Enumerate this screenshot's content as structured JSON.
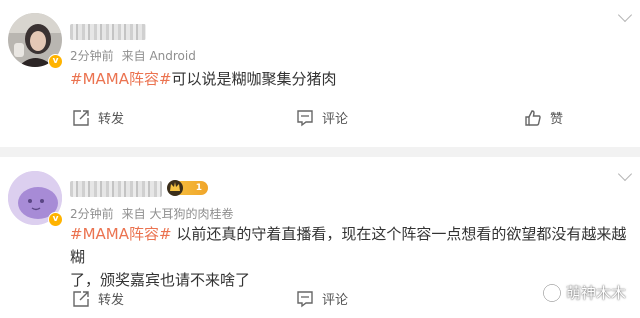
{
  "post1": {
    "meta": {
      "time": "2分钟前",
      "source": "来自 Android"
    },
    "hashtag": "#MAMA阵容#",
    "text": "可以说是糊咖聚集分猪肉",
    "actions": {
      "repost": "转发",
      "comment": "评论",
      "like": "赞"
    }
  },
  "post2": {
    "fan_level": "1",
    "meta": {
      "time": "2分钟前",
      "source": "来自 大耳狗的肉桂卷"
    },
    "hashtag": "#MAMA阵容#",
    "text_line1": " 以前还真的守着直播看，现在这个阵容一点想看的欲望都没有越来越糊",
    "text_line2": "了，颁奖嘉宾也请不来啥了",
    "actions": {
      "repost": "转发",
      "comment": "评论"
    }
  },
  "watermark": {
    "text": "萌神木木"
  },
  "colors": {
    "accent": "#eb7350",
    "meta_gray": "#8f8f8f",
    "separator": "#f2f2f2",
    "badge": "#ffb300"
  }
}
